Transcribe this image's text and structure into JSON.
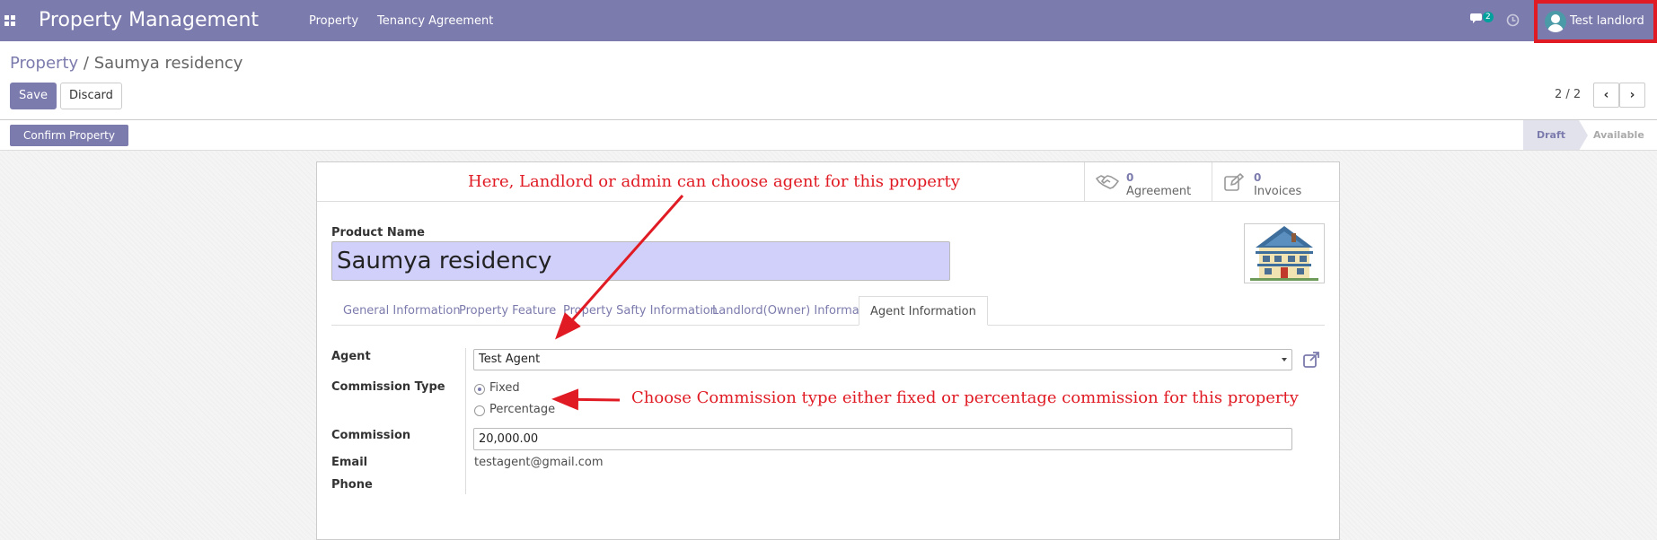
{
  "navbar": {
    "brand": "Property Management",
    "menu": [
      "Property",
      "Tenancy Agreement"
    ],
    "message_count": "2",
    "user_name": "Test landlord"
  },
  "breadcrumb": {
    "parent": "Property",
    "separator": " / ",
    "current": "Saumya residency"
  },
  "buttons": {
    "save": "Save",
    "discard": "Discard",
    "confirm": "Confirm Property"
  },
  "pager": {
    "value": "2 / 2"
  },
  "stages": {
    "draft": "Draft",
    "available": "Available"
  },
  "smart_buttons": [
    {
      "value": "0",
      "label": "Agreement",
      "icon": "handshake-icon"
    },
    {
      "value": "0",
      "label": "Invoices",
      "icon": "edit-icon"
    }
  ],
  "annotations": {
    "agent": "Here, Landlord or admin can choose agent for this property",
    "commission": "Choose Commission type either fixed or percentage commission for this property",
    "color": "#e01b24"
  },
  "form": {
    "product_name_label": "Product Name",
    "product_name": "Saumya residency",
    "tabs": [
      "General Information",
      "Property Feature",
      "Property Safty Information",
      "Landlord(Owner) Information",
      "Agent Information"
    ],
    "active_tab": "Agent Information",
    "agent_label": "Agent",
    "agent_value": "Test Agent",
    "commission_type_label": "Commission Type",
    "commission_type_options": [
      "Fixed",
      "Percentage"
    ],
    "commission_type_selected": "Fixed",
    "commission_label": "Commission",
    "commission_value": "20,000.00",
    "email_label": "Email",
    "email_value": "testagent@gmail.com",
    "phone_label": "Phone",
    "phone_value": ""
  },
  "colors": {
    "brand": "#7c7bad",
    "name_highlight": "#d0d0fa",
    "badge": "#00a09d"
  }
}
